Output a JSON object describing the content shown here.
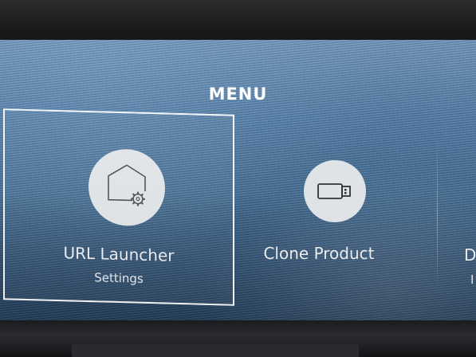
{
  "menu": {
    "title": "MENU",
    "tiles": [
      {
        "label": "URL Launcher",
        "sublabel": "Settings",
        "icon": "house-gear-icon",
        "selected": true
      },
      {
        "label": "Clone Product",
        "sublabel": "",
        "icon": "usb-drive-icon",
        "selected": false
      },
      {
        "label": "D",
        "sublabel": "I",
        "icon": "",
        "selected": false
      }
    ]
  },
  "colors": {
    "screen_background": "#4f7aa4",
    "text": "#ffffff",
    "icon_circle": "#f0f0f0",
    "bezel": "#1a1b1d"
  }
}
